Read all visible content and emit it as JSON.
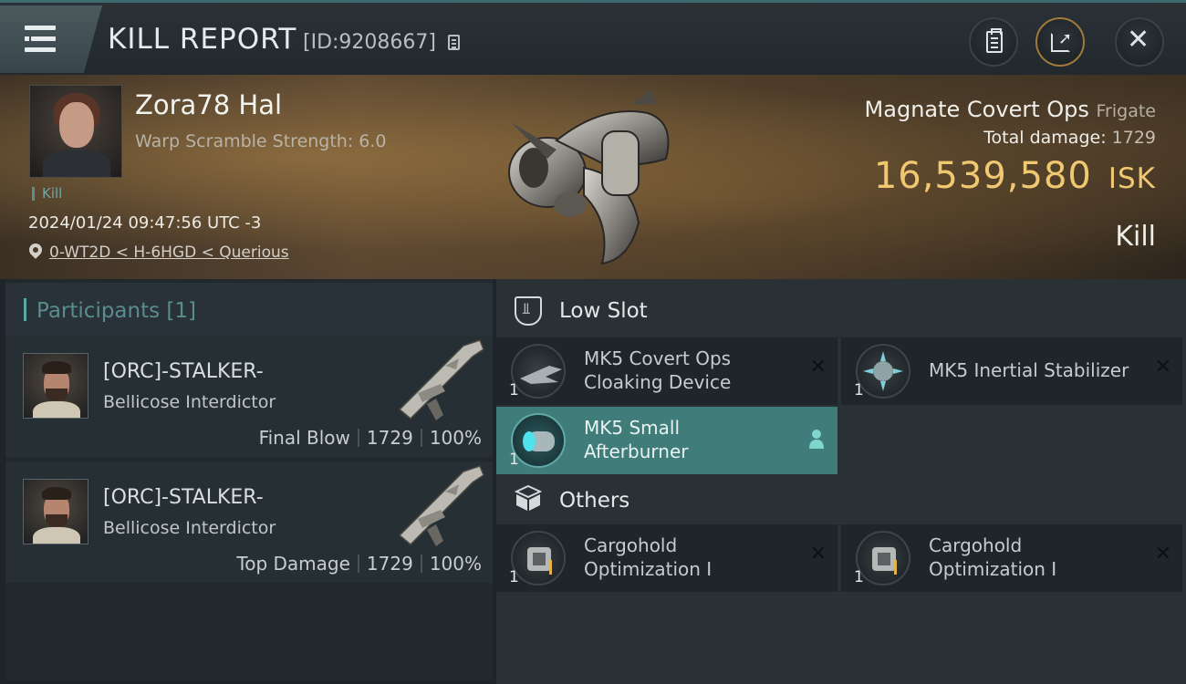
{
  "header": {
    "title": "KILL REPORT",
    "report_id": "[ID:9208667]"
  },
  "victim": {
    "name": "Zora78 Hal",
    "warp_scramble": "Warp Scramble Strength: 6.0",
    "tag": "Kill",
    "timestamp": "2024/01/24 09:47:56 UTC -3",
    "location": "0-WT2D < H-6HGD < Querious"
  },
  "ship": {
    "name": "Magnate Covert Ops",
    "class": "Frigate",
    "total_damage_label": "Total damage:",
    "total_damage": "1729",
    "isk_value": "16,539,580",
    "isk_unit": "ISK",
    "result": "Kill"
  },
  "participants": {
    "title": "Participants [1]",
    "list": [
      {
        "name": "[ORC]-STALKER-",
        "ship": "Bellicose Interdictor",
        "role": "Final Blow",
        "damage": "1729",
        "percent": "100%"
      },
      {
        "name": "[ORC]-STALKER-",
        "ship": "Bellicose Interdictor",
        "role": "Top Damage",
        "damage": "1729",
        "percent": "100%"
      }
    ]
  },
  "sections": {
    "low_slot": {
      "title": "Low Slot",
      "items": [
        {
          "name": "MK5 Covert Ops Cloaking Device",
          "qty": "1"
        },
        {
          "name": "MK5 Inertial Stabilizer",
          "qty": "1"
        },
        {
          "name": "MK5 Small Afterburner",
          "qty": "1"
        }
      ]
    },
    "others": {
      "title": "Others",
      "items": [
        {
          "name": "Cargohold Optimization I",
          "qty": "1"
        },
        {
          "name": "Cargohold Optimization I",
          "qty": "1"
        }
      ]
    }
  },
  "colors": {
    "accent": "#3f7c7a",
    "isk_gold": "#f0c871",
    "kill_teal": "#72a6a4"
  }
}
